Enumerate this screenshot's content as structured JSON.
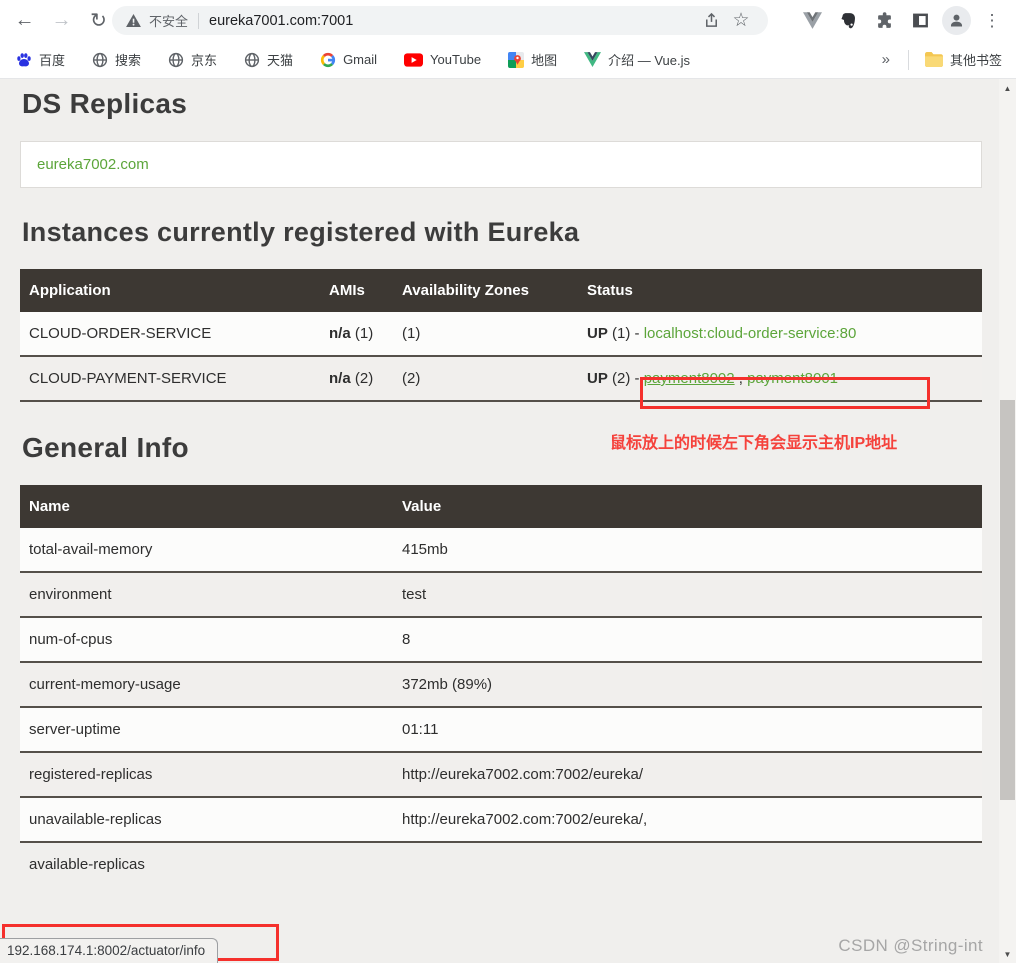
{
  "browser": {
    "toolbar": {
      "back_icon": "←",
      "forward_icon": "→",
      "reload_icon": "↻",
      "security_label": "不安全",
      "url": "eureka7001.com:7001",
      "star_icon": "☆",
      "menu_icon": "⋮"
    },
    "bookmarks": {
      "items": [
        {
          "label": "百度",
          "icon": "baidu-paw-icon"
        },
        {
          "label": "搜索",
          "icon": "globe-icon"
        },
        {
          "label": "京东",
          "icon": "globe-icon"
        },
        {
          "label": "天猫",
          "icon": "globe-icon"
        },
        {
          "label": "Gmail",
          "icon": "google-g-icon"
        },
        {
          "label": "YouTube",
          "icon": "youtube-icon"
        },
        {
          "label": "地图",
          "icon": "google-maps-icon"
        },
        {
          "label": "介绍 — Vue.js",
          "icon": "vue-icon"
        }
      ],
      "overflow_chevron": "»",
      "other_bookmarks": "其他书签"
    }
  },
  "page": {
    "ds_replicas": {
      "title": "DS Replicas",
      "replica": "eureka7002.com"
    },
    "instances": {
      "title": "Instances currently registered with Eureka",
      "headers": [
        "Application",
        "AMIs",
        "Availability Zones",
        "Status"
      ],
      "rows": [
        {
          "application": "CLOUD-ORDER-SERVICE",
          "amis_bold": "n/a",
          "amis_count": "(1)",
          "zones": "(1)",
          "status_bold": "UP",
          "status_count": "(1)",
          "dash": "-",
          "link": "localhost:cloud-order-service:80"
        },
        {
          "application": "CLOUD-PAYMENT-SERVICE",
          "amis_bold": "n/a",
          "amis_count": "(2)",
          "zones": "(2)",
          "status_bold": "UP",
          "status_count": "(2)",
          "dash": "-",
          "link_a": "payment8002",
          "comma": ",",
          "link_b": "payment8001"
        }
      ]
    },
    "annotation_text": "鼠标放上的时候左下角会显示主机IP地址",
    "general_info": {
      "title": "General Info",
      "headers": [
        "Name",
        "Value"
      ],
      "rows": [
        {
          "name": "total-avail-memory",
          "value": "415mb"
        },
        {
          "name": "environment",
          "value": "test"
        },
        {
          "name": "num-of-cpus",
          "value": "8"
        },
        {
          "name": "current-memory-usage",
          "value": "372mb (89%)"
        },
        {
          "name": "server-uptime",
          "value": "01:11"
        },
        {
          "name": "registered-replicas",
          "value": "http://eureka7002.com:7002/eureka/"
        },
        {
          "name": "unavailable-replicas",
          "value": "http://eureka7002.com:7002/eureka/,"
        },
        {
          "name": "available-replicas",
          "value": ""
        }
      ]
    },
    "status_bubble": "192.168.174.1:8002/actuator/info",
    "watermark": "CSDN @String-int"
  },
  "colors": {
    "accent_green": "#5ca53a",
    "annotation_red": "#f5302c",
    "table_header_bg": "#3d3833"
  }
}
